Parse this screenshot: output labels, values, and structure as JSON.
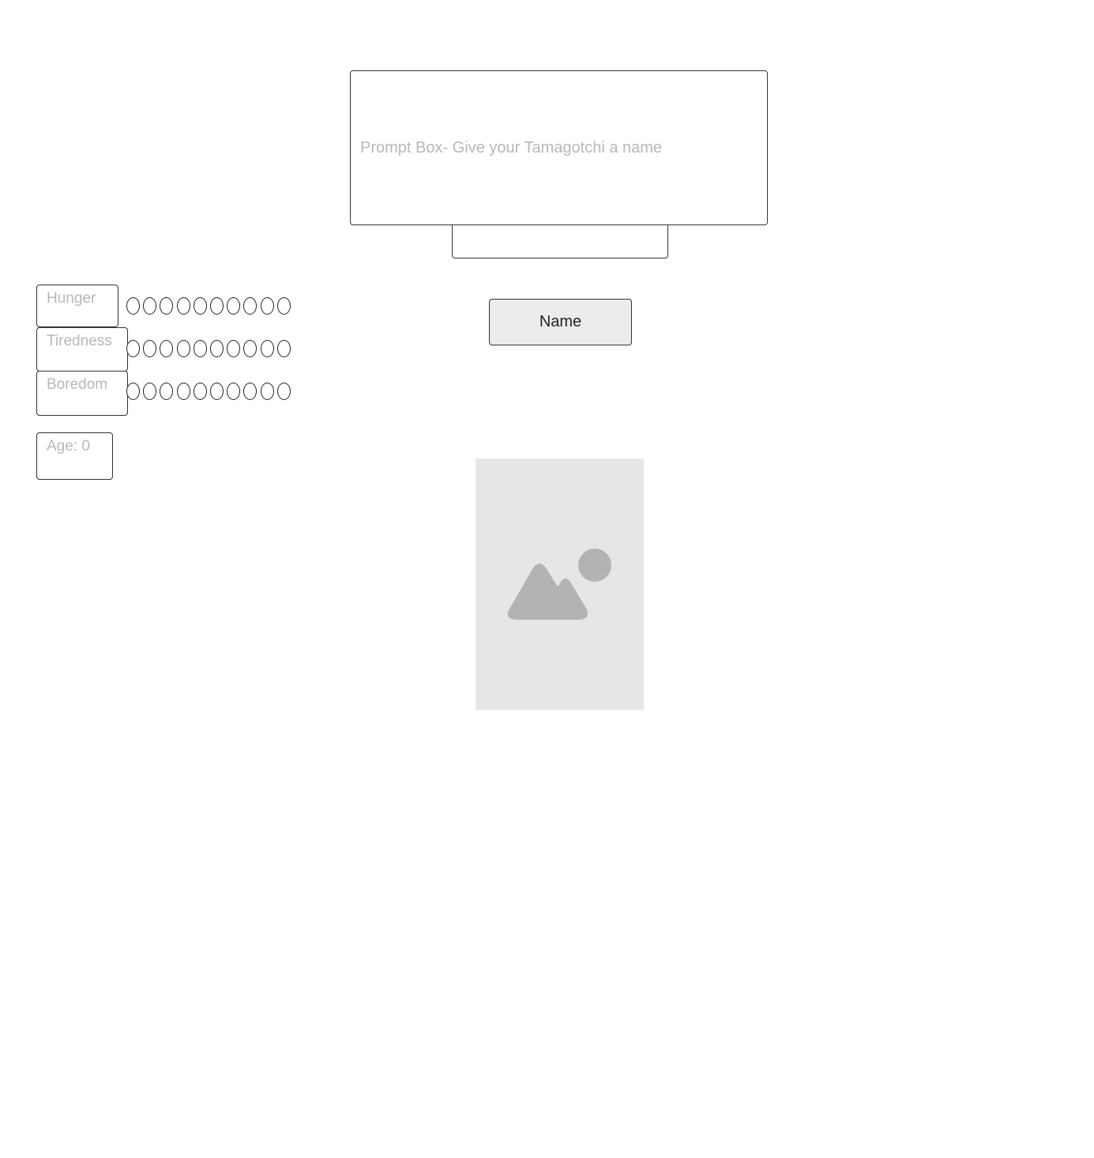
{
  "prompt": {
    "text": "Prompt Box- Give your Tamagotchi a name"
  },
  "name_input": {
    "value": "",
    "placeholder": ""
  },
  "name_button": {
    "label": "Name"
  },
  "stats": {
    "hunger": {
      "label": "Hunger",
      "pips": 10
    },
    "tiredness": {
      "label": "Tiredness",
      "pips": 10
    },
    "boredom": {
      "label": "Boredom",
      "pips": 10
    },
    "age": {
      "label": "Age: 0"
    }
  },
  "image": {
    "icon": "image-placeholder-icon"
  },
  "colors": {
    "border": "#333333",
    "placeholder_text": "#b8b8b8",
    "button_bg": "#ececec",
    "image_bg": "#e6e6e6",
    "image_icon": "#b3b3b3"
  }
}
